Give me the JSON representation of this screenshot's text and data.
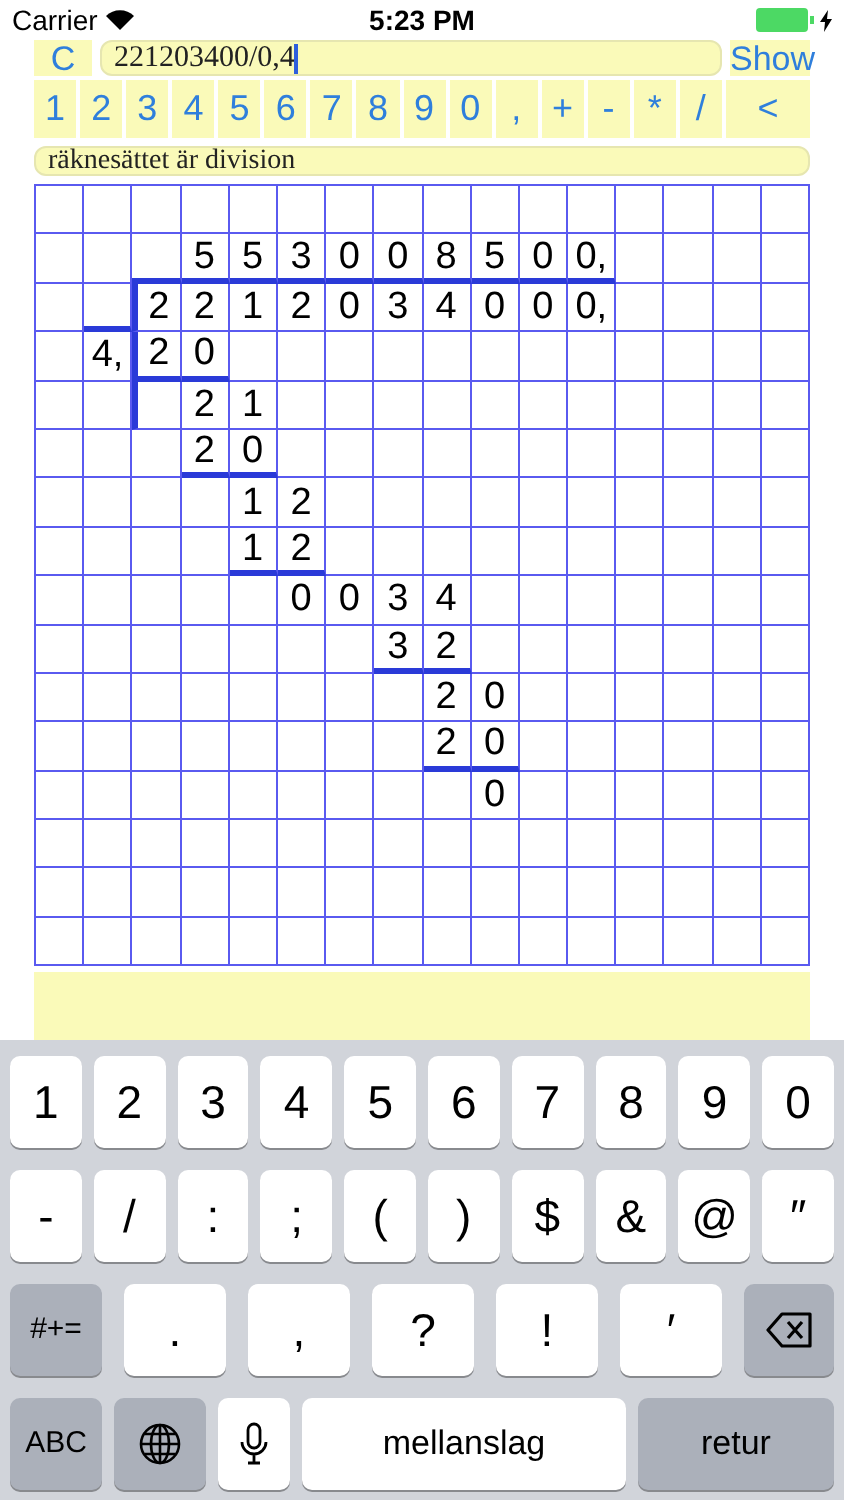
{
  "status_bar": {
    "carrier": "Carrier",
    "time": "5:23 PM"
  },
  "toolbar": {
    "clear": "C",
    "expression": "221203400/0,4",
    "show": "Show"
  },
  "keypad": [
    "1",
    "2",
    "3",
    "4",
    "5",
    "6",
    "7",
    "8",
    "9",
    "0",
    ",",
    "+",
    "-",
    "*",
    "/",
    "<"
  ],
  "message": "räknesättet är division",
  "grid": {
    "rows": [
      {
        "cells": [
          {},
          {},
          {},
          {},
          {},
          {},
          {},
          {},
          {},
          {},
          {},
          {},
          {},
          {},
          {},
          {}
        ]
      },
      {
        "cells": [
          {},
          {},
          {
            "underline": true
          },
          {
            "text": "5",
            "underline": true
          },
          {
            "text": "5",
            "underline": true
          },
          {
            "text": "3",
            "underline": true
          },
          {
            "text": "0",
            "underline": true
          },
          {
            "text": "0",
            "underline": true
          },
          {
            "text": "8",
            "underline": true
          },
          {
            "text": "5",
            "underline": true
          },
          {
            "text": "0",
            "underline": true
          },
          {
            "text": "0,",
            "underline": true
          },
          {},
          {},
          {},
          {}
        ]
      },
      {
        "cells": [
          {},
          {
            "underline": true
          },
          {
            "text": "2",
            "bar_left": true
          },
          {
            "text": "2"
          },
          {
            "text": "1"
          },
          {
            "text": "2"
          },
          {
            "text": "0"
          },
          {
            "text": "3"
          },
          {
            "text": "4"
          },
          {
            "text": "0"
          },
          {
            "text": "0"
          },
          {
            "text": "0,"
          },
          {},
          {},
          {},
          {}
        ]
      },
      {
        "cells": [
          {},
          {
            "text": "4,"
          },
          {
            "text": "2",
            "bar_left": true,
            "underline": true
          },
          {
            "text": "0",
            "underline": true
          },
          {},
          {},
          {},
          {},
          {},
          {},
          {},
          {},
          {},
          {},
          {},
          {}
        ]
      },
      {
        "cells": [
          {},
          {},
          {
            "bar_left": true
          },
          {
            "text": "2"
          },
          {
            "text": "1"
          },
          {},
          {},
          {},
          {},
          {},
          {},
          {},
          {},
          {},
          {},
          {}
        ]
      },
      {
        "cells": [
          {},
          {},
          {},
          {
            "text": "2",
            "underline": true
          },
          {
            "text": "0",
            "underline": true
          },
          {},
          {},
          {},
          {},
          {},
          {},
          {},
          {},
          {},
          {},
          {}
        ]
      },
      {
        "cells": [
          {},
          {},
          {},
          {},
          {
            "text": "1"
          },
          {
            "text": "2"
          },
          {},
          {},
          {},
          {},
          {},
          {},
          {},
          {},
          {},
          {}
        ]
      },
      {
        "cells": [
          {},
          {},
          {},
          {},
          {
            "text": "1",
            "underline": true
          },
          {
            "text": "2",
            "underline": true
          },
          {},
          {},
          {},
          {},
          {},
          {},
          {},
          {},
          {},
          {}
        ]
      },
      {
        "cells": [
          {},
          {},
          {},
          {},
          {},
          {
            "text": "0"
          },
          {
            "text": "0"
          },
          {
            "text": "3"
          },
          {
            "text": "4"
          },
          {},
          {},
          {},
          {},
          {},
          {},
          {}
        ]
      },
      {
        "cells": [
          {},
          {},
          {},
          {},
          {},
          {},
          {},
          {
            "text": "3",
            "underline": true
          },
          {
            "text": "2",
            "underline": true
          },
          {},
          {},
          {},
          {},
          {},
          {},
          {}
        ]
      },
      {
        "cells": [
          {},
          {},
          {},
          {},
          {},
          {},
          {},
          {},
          {
            "text": "2"
          },
          {
            "text": "0"
          },
          {},
          {},
          {},
          {},
          {},
          {}
        ]
      },
      {
        "cells": [
          {},
          {},
          {},
          {},
          {},
          {},
          {},
          {},
          {
            "text": "2",
            "underline": true
          },
          {
            "text": "0",
            "underline": true
          },
          {},
          {},
          {},
          {},
          {},
          {}
        ]
      },
      {
        "cells": [
          {},
          {},
          {},
          {},
          {},
          {},
          {},
          {},
          {},
          {
            "text": "0"
          },
          {},
          {},
          {},
          {},
          {},
          {}
        ]
      },
      {
        "cells": [
          {},
          {},
          {},
          {},
          {},
          {},
          {},
          {},
          {},
          {},
          {},
          {},
          {},
          {},
          {},
          {}
        ]
      },
      {
        "cells": [
          {},
          {},
          {},
          {},
          {},
          {},
          {},
          {},
          {},
          {},
          {},
          {},
          {},
          {},
          {},
          {}
        ]
      },
      {
        "cells": [
          {},
          {},
          {},
          {},
          {},
          {},
          {},
          {},
          {},
          {},
          {},
          {},
          {},
          {},
          {},
          {}
        ]
      }
    ]
  },
  "keyboard": {
    "rows": [
      {
        "keys": [
          {
            "kind": "key",
            "label": "1"
          },
          {
            "kind": "key",
            "label": "2"
          },
          {
            "kind": "key",
            "label": "3"
          },
          {
            "kind": "key",
            "label": "4"
          },
          {
            "kind": "key",
            "label": "5"
          },
          {
            "kind": "key",
            "label": "6"
          },
          {
            "kind": "key",
            "label": "7"
          },
          {
            "kind": "key",
            "label": "8"
          },
          {
            "kind": "key",
            "label": "9"
          },
          {
            "kind": "key",
            "label": "0"
          }
        ]
      },
      {
        "keys": [
          {
            "kind": "key",
            "label": "-"
          },
          {
            "kind": "key",
            "label": "/"
          },
          {
            "kind": "key",
            "label": ":"
          },
          {
            "kind": "key",
            "label": ";"
          },
          {
            "kind": "key",
            "label": "("
          },
          {
            "kind": "key",
            "label": ")"
          },
          {
            "kind": "key",
            "label": "$"
          },
          {
            "kind": "key",
            "label": "&"
          },
          {
            "kind": "key",
            "label": "@"
          },
          {
            "kind": "key",
            "label": "″"
          }
        ]
      },
      {
        "keys": [
          {
            "kind": "mod",
            "label": "#+="
          },
          {
            "kind": "wide",
            "label": "."
          },
          {
            "kind": "wide",
            "label": ","
          },
          {
            "kind": "wide",
            "label": "?"
          },
          {
            "kind": "wide",
            "label": "!"
          },
          {
            "kind": "wide",
            "label": "′"
          },
          {
            "kind": "delete"
          }
        ]
      },
      {
        "keys": [
          {
            "kind": "mod",
            "label": "ABC"
          },
          {
            "kind": "globe"
          },
          {
            "kind": "mic"
          },
          {
            "kind": "space",
            "label": "mellanslag"
          },
          {
            "kind": "return",
            "label": "retur"
          }
        ]
      }
    ]
  }
}
